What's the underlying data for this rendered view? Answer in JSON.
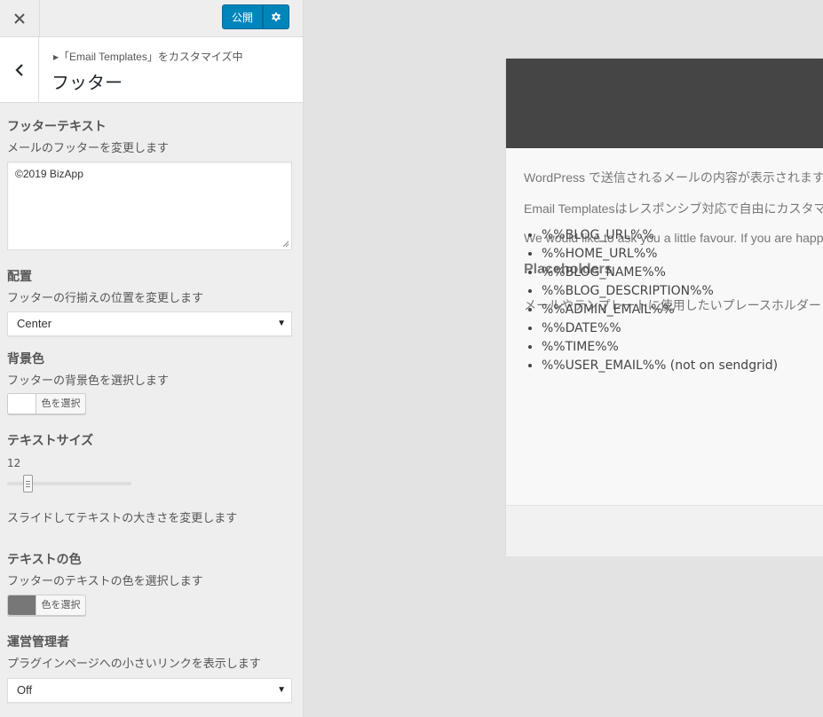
{
  "topbar": {
    "publish_label": "公開"
  },
  "section": {
    "breadcrumb": "▸「Email Templates」をカスタマイズ中",
    "title": "フッター"
  },
  "controls": {
    "footer_text": {
      "title": "フッターテキスト",
      "desc": "メールのフッターを変更します",
      "value": "©2019 BizApp"
    },
    "alignment": {
      "title": "配置",
      "desc": "フッターの行揃えの位置を変更します",
      "selected": "Center"
    },
    "bg_color": {
      "title": "背景色",
      "desc": "フッターの背景色を選択します",
      "button_label": "色を選択",
      "swatch": "#ffffff"
    },
    "text_size": {
      "title": "テキストサイズ",
      "value": "12",
      "desc": "スライドしてテキストの大きさを変更します"
    },
    "text_color": {
      "title": "テキストの色",
      "desc": "フッターのテキストの色を選択します",
      "button_label": "色を選択",
      "swatch": "#777777"
    },
    "admin_link": {
      "title": "運営管理者",
      "desc": "プラグインページへの小さいリンクを表示します",
      "selected": "Off"
    }
  },
  "preview": {
    "header_color": "#454545",
    "lines": [
      "WordPress で送信されるメールの内容が表示されます",
      "Email Templatesはレスポンシブ対応で自由にカスタマ",
      "We would like to ask you a little favour. If you are happ"
    ],
    "placeholders_title": "Placeholders",
    "placeholders_desc": "メールやテンプレートに使用したいプレースホルダー",
    "placeholders": [
      "%%BLOG_URL%%",
      "%%HOME_URL%%",
      "%%BLOG_NAME%%",
      "%%BLOG_DESCRIPTION%%",
      "%%ADMIN_EMAIL%%",
      "%%DATE%%",
      "%%TIME%%",
      "%%USER_EMAIL%% (not on sendgrid)"
    ]
  },
  "colors": {
    "accent": "#0085ba"
  }
}
